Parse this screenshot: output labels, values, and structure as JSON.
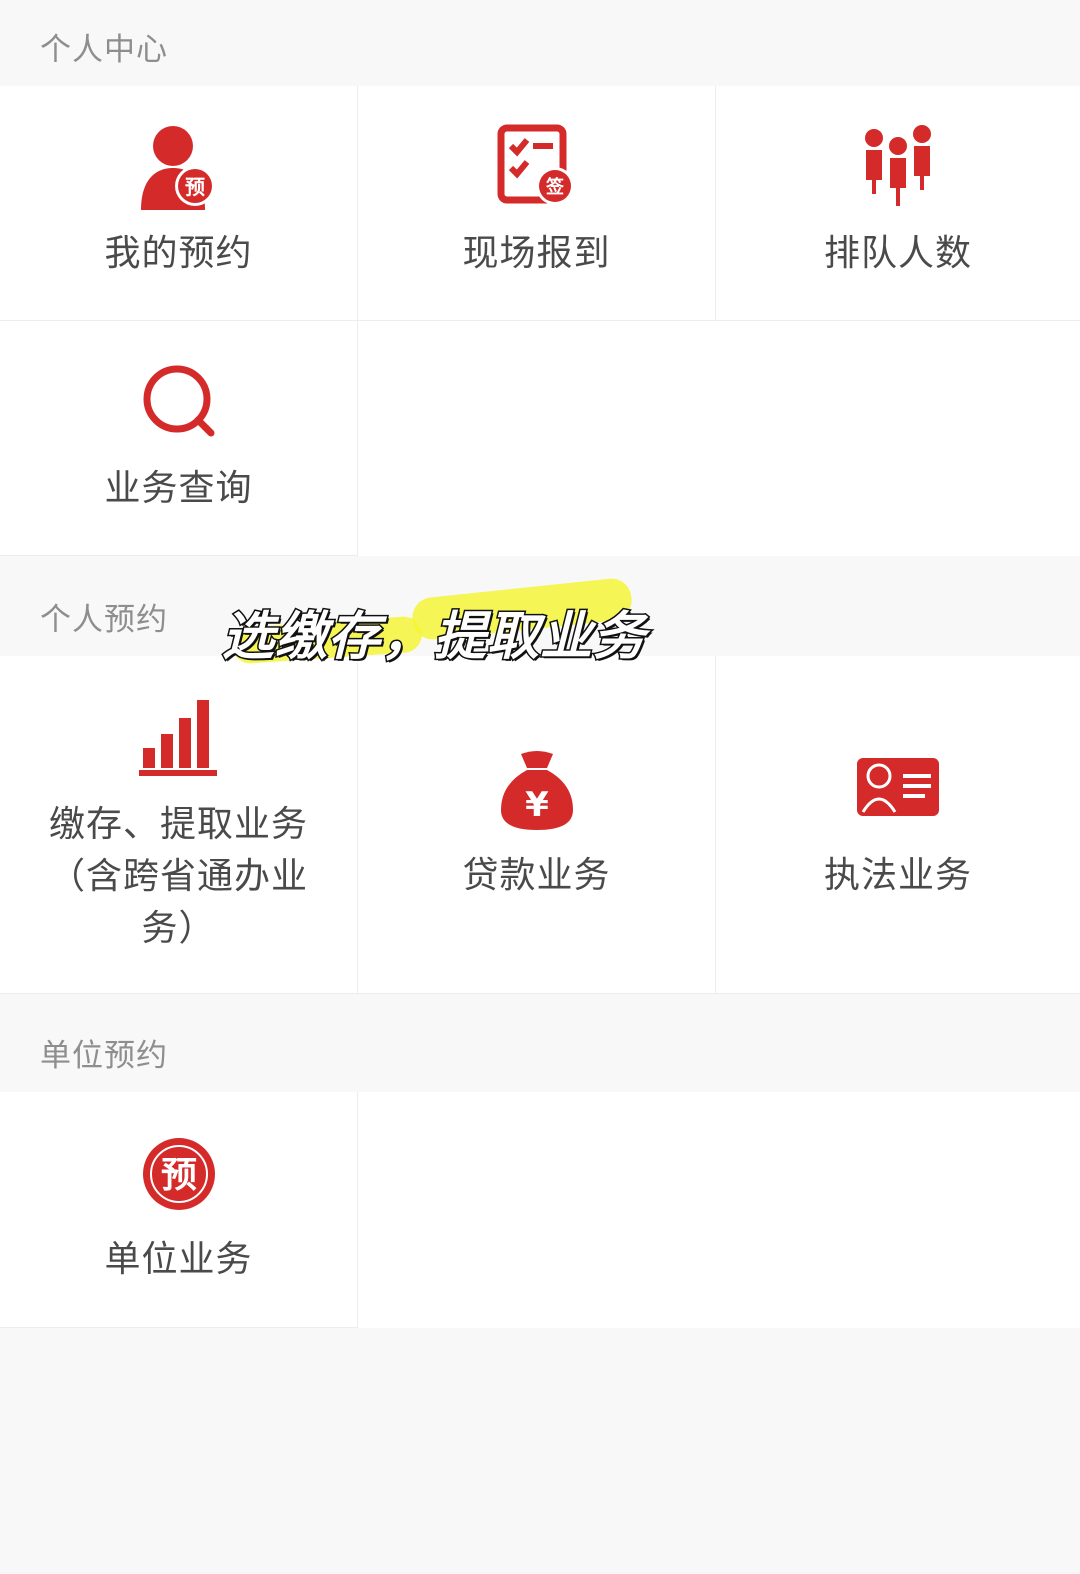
{
  "sections": {
    "personal_center": {
      "title": "个人中心"
    },
    "personal_booking": {
      "title": "个人预约"
    },
    "unit_booking": {
      "title": "单位预约"
    }
  },
  "items": {
    "my_booking": {
      "label": "我的预约",
      "icon": "user-booking-icon"
    },
    "checkin": {
      "label": "现场报到",
      "icon": "checklist-sign-icon"
    },
    "queue": {
      "label": "排队人数",
      "icon": "queue-people-icon"
    },
    "query": {
      "label": "业务查询",
      "icon": "search-icon"
    },
    "deposit_line1": "缴存、提取业务",
    "deposit_line2": "（含跨省通办业",
    "deposit_line3": "务）",
    "loan": {
      "label": "贷款业务",
      "icon": "money-bag-icon"
    },
    "law": {
      "label": "执法业务",
      "icon": "id-card-icon"
    },
    "unit": {
      "label": "单位业务",
      "icon": "booking-seal-icon"
    }
  },
  "overlay_caption": "选缴存，提取业务",
  "colors": {
    "accent": "#d42a2a",
    "section_bg": "#f8f8f8",
    "highlight": "#f5f53a"
  }
}
